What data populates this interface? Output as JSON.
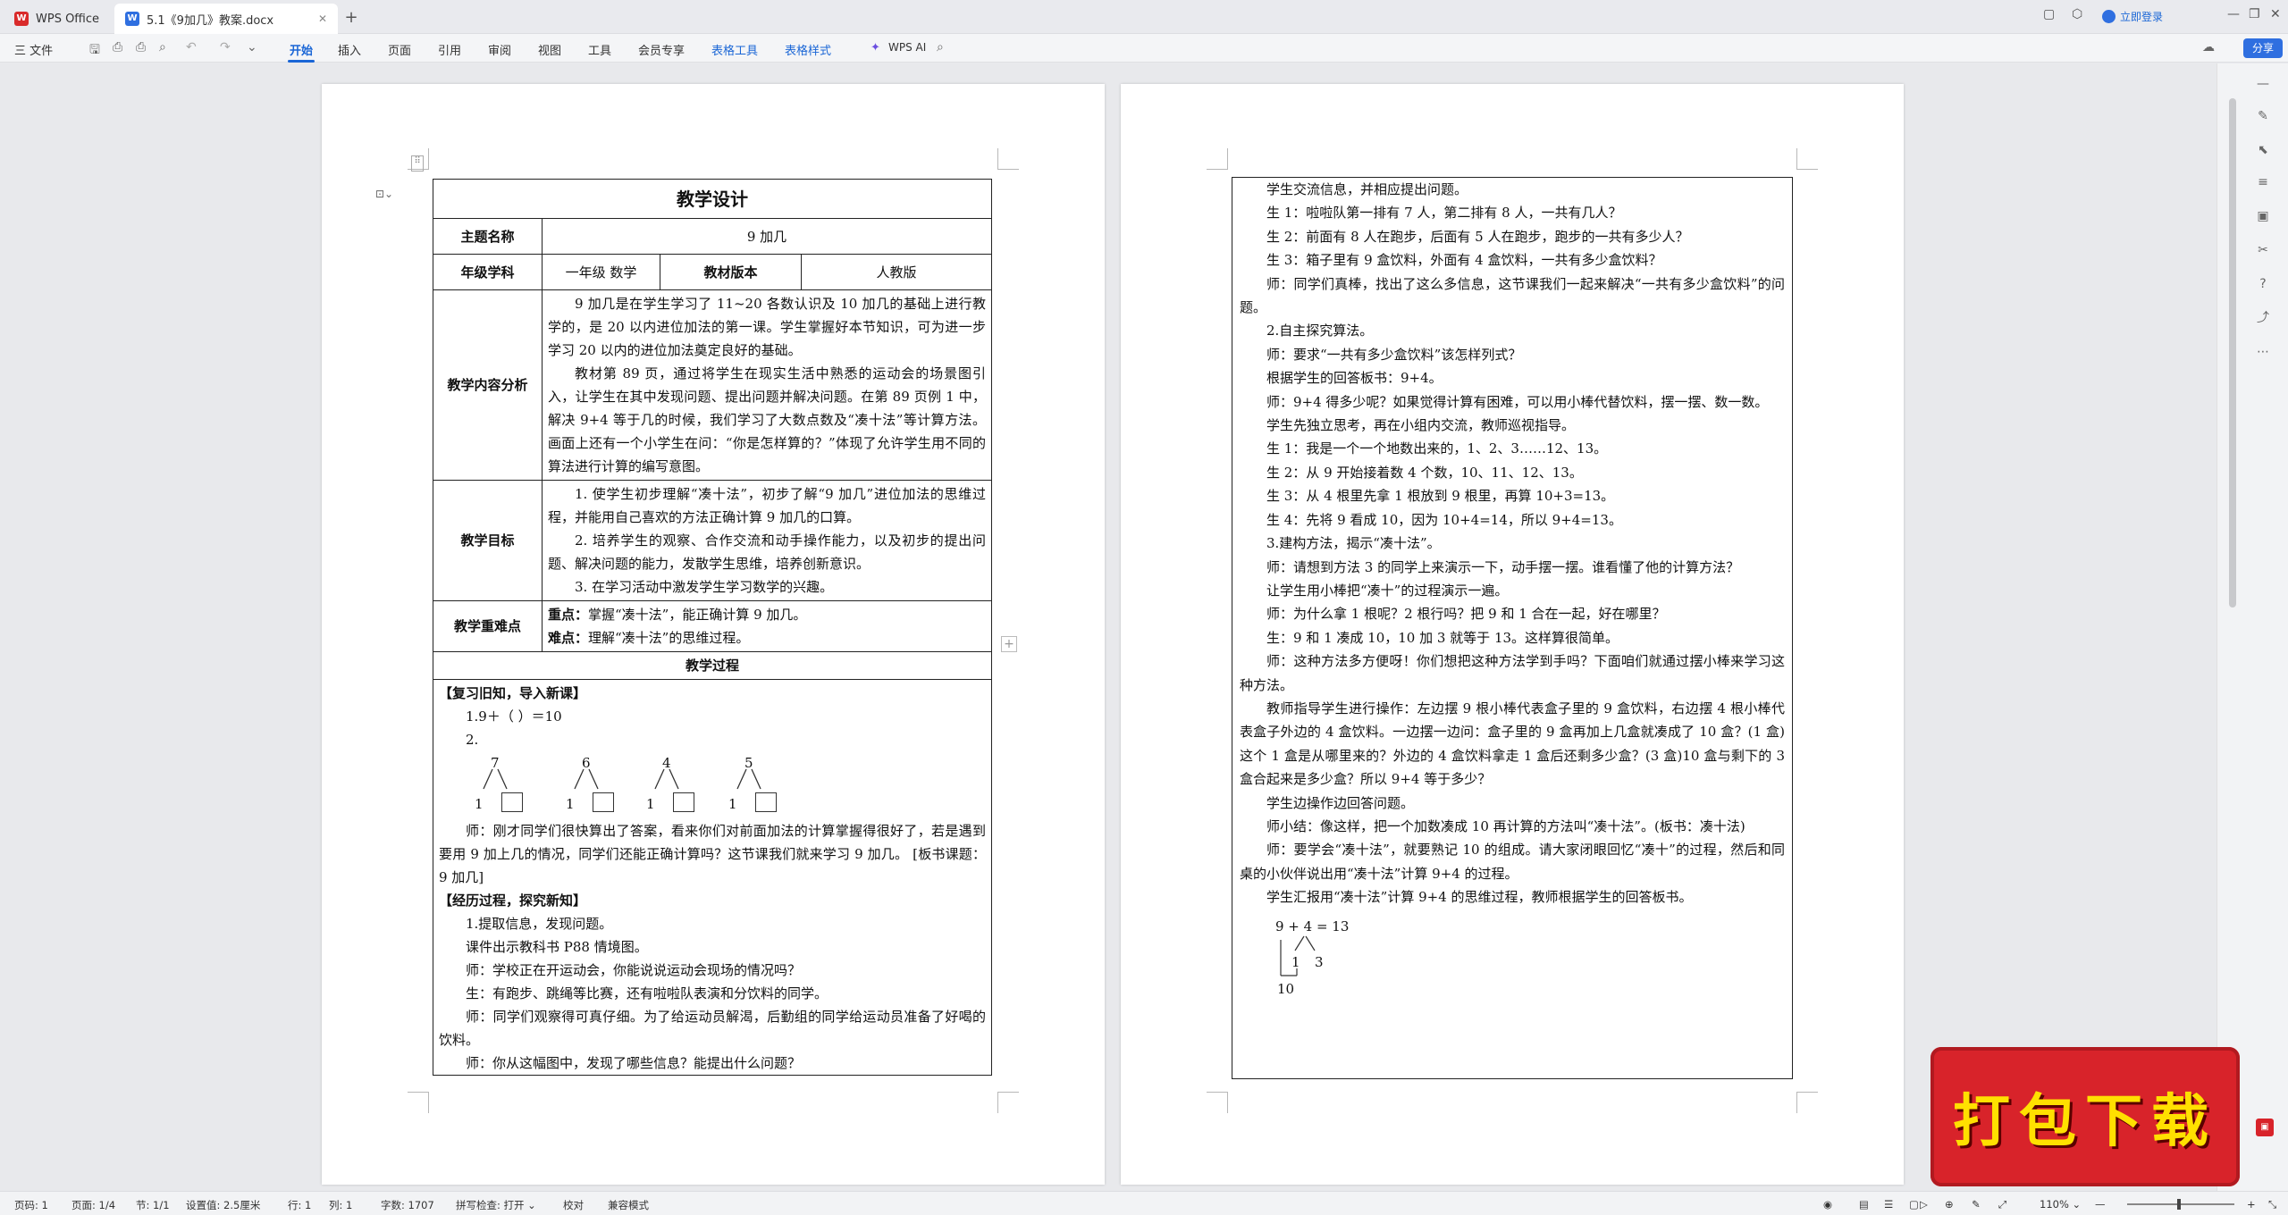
{
  "tabs": {
    "home": "WPS Office",
    "doc": "5.1《9加几》教案.docx"
  },
  "login": "立即登录",
  "ribbon": {
    "file": "三 文件",
    "items": [
      "开始",
      "插入",
      "页面",
      "引用",
      "审阅",
      "视图",
      "工具",
      "会员专享"
    ],
    "context": [
      "表格工具",
      "表格样式"
    ],
    "wpsai": "WPS AI",
    "share": "分享"
  },
  "page1": {
    "title": "教学设计",
    "rows": {
      "theme_label": "主题名称",
      "theme_value": "9 加几",
      "grade_label": "年级学科",
      "grade_value": "一年级  数学",
      "edition_label": "教材版本",
      "edition_value": "人教版",
      "analysis_label": "教学内容分析",
      "analysis_p1": "9 加几是在学生学习了 11~20 各数认识及 10 加几的基础上进行教学的，是 20 以内进位加法的第一课。学生掌握好本节知识，可为进一步学习 20 以内的进位加法奠定良好的基础。",
      "analysis_p2": "教材第 89 页，通过将学生在现实生活中熟悉的运动会的场景图引入，让学生在其中发现问题、提出问题并解决问题。在第 89 页例 1 中，解决 9+4 等于几的时候，我们学习了大数点数及“凑十法”等计算方法。画面上还有一个小学生在问：“你是怎样算的？”体现了允许学生用不同的算法进行计算的编写意图。",
      "goal_label": "教学目标",
      "goal_1": "1. 使学生初步理解“凑十法”，初步了解“9 加几”进位加法的思维过程，并能用自己喜欢的方法正确计算 9 加几的口算。",
      "goal_2": "2. 培养学生的观察、合作交流和动手操作能力，以及初步的提出问题、解决问题的能力，发散学生思维，培养创新意识。",
      "goal_3": "3. 在学习活动中激发学生学习数学的兴趣。",
      "key_label": "教学重难点",
      "key_1_b": "重点：",
      "key_1": "掌握“凑十法”，能正确计算 9 加几。",
      "key_2_b": "难点：",
      "key_2": "理解“凑十法”的思维过程。",
      "process_label": "教学过程"
    },
    "process": {
      "sec1": "【复习旧知，导入新课】",
      "q1": "1.9＋（      ）＝10",
      "q2": "2.",
      "diagram": [
        {
          "top": "7",
          "bottom": "1"
        },
        {
          "top": "6",
          "bottom": "1"
        },
        {
          "top": "4",
          "bottom": "1"
        },
        {
          "top": "5",
          "bottom": "1"
        }
      ],
      "t1": "师：刚才同学们很快算出了答案，看来你们对前面加法的计算掌握得很好了，若是遇到要用 9 加上几的情况，同学们还能正确计算吗？这节课我们就来学习 9 加几。 [板书课题：9 加几]",
      "sec2": "【经历过程，探究新知】",
      "l1": "1.提取信息，发现问题。",
      "l2": "课件出示教科书 P88 情境图。",
      "l3": "师：学校正在开运动会，你能说说运动会现场的情况吗？",
      "l4": "生：有跑步、跳绳等比赛，还有啦啦队表演和分饮料的同学。",
      "l5": "师：同学们观察得可真仔细。为了给运动员解渴，后勤组的同学给运动员准备了好喝的饮料。",
      "l6": "师：你从这幅图中，发现了哪些信息？能提出什么问题？"
    }
  },
  "page2": {
    "lines": [
      "学生交流信息，并相应提出问题。",
      "生 1：啦啦队第一排有 7 人，第二排有 8 人，一共有几人？",
      "生 2：前面有 8 人在跑步，后面有 5 人在跑步，跑步的一共有多少人？",
      "生 3：箱子里有 9 盒饮料，外面有 4 盒饮料，一共有多少盒饮料？",
      "师：同学们真棒，找出了这么多信息，这节课我们一起来解决“一共有多少盒饮料”的问题。",
      "2.自主探究算法。",
      "师：要求“一共有多少盒饮料”该怎样列式？",
      "根据学生的回答板书：9+4。",
      "师：9+4 得多少呢？如果觉得计算有困难，可以用小棒代替饮料，摆一摆、数一数。",
      "学生先独立思考，再在小组内交流，教师巡视指导。",
      "生 1：我是一个一个地数出来的，1、2、3……12、13。",
      "生 2：从 9 开始接着数 4 个数，10、11、12、13。",
      "生 3：从 4 根里先拿 1 根放到 9 根里，再算 10+3=13。",
      "生 4：先将 9 看成 10，因为 10+4=14，所以 9+4=13。",
      "3.建构方法，揭示“凑十法”。",
      "师：请想到方法 3 的同学上来演示一下，动手摆一摆。谁看懂了他的计算方法？",
      "让学生用小棒把“凑十”的过程演示一遍。",
      "师：为什么拿 1 根呢？2 根行吗？把 9 和 1 合在一起，好在哪里？",
      "生：9 和 1 凑成 10，10 加 3 就等于 13。这样算很简单。",
      "师：这种方法多方便呀！你们想把这种方法学到手吗？下面咱们就通过摆小棒来学习这种方法。",
      "教师指导学生进行操作：左边摆 9 根小棒代表盒子里的 9 盒饮料，右边摆 4 根小棒代表盒子外边的 4 盒饮料。一边摆一边问：盒子里的 9 盒再加上几盒就凑成了 10 盒？(1 盒)这个 1 盒是从哪里来的？外边的 4 盒饮料拿走 1 盒后还剩多少盒？(3 盒)10 盒与剩下的 3 盒合起来是多少盒？所以 9+4 等于多少？",
      "学生边操作边回答问题。",
      "师小结：像这样，把一个加数凑成 10 再计算的方法叫“凑十法”。(板书：凑十法)",
      "师：要学会“凑十法”，就要熟记 10 的组成。请大家闭眼回忆“凑十”的过程，然后和同桌的小伙伴说出用“凑十法”计算 9+4 的过程。",
      "学生汇报用“凑十法”计算 9+4 的思维过程，教师根据学生的回答板书。"
    ],
    "calc": {
      "eq": "9 + 4 = 13",
      "a": "1",
      "b": "3",
      "ten": "10"
    }
  },
  "status": {
    "page": "页码: 1",
    "pages": "页面: 1/4",
    "section": "节: 1/1",
    "setting": "设置值: 2.5厘米",
    "row": "行: 1",
    "col": "列: 1",
    "words": "字数: 1707",
    "spell": "拼写检查: 打开 ⌄",
    "proof": "校对",
    "compat": "兼容模式",
    "zoom": "110% ⌄"
  },
  "badge": "打包下载"
}
